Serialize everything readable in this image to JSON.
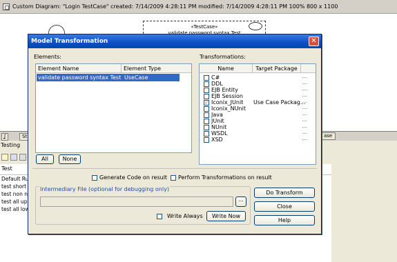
{
  "app": {
    "title_bar": "Custom Diagram: \"Login TestCase\"  created: 7/14/2009 4:28:11 PM  modified: 7/14/2009 4:28:11 PM   100%   800 x 1100",
    "usecase_stereotype": "«TestCase»",
    "usecase_name": "validate password syntax Test",
    "tab_left": "ʆ",
    "tab_st": "St",
    "tab_case": "ase",
    "testing_title": "Testing",
    "test_col": "Test",
    "test_items": [
      "Default Run",
      "test short p",
      "test non nu",
      "test all uppe",
      "test all lowe"
    ]
  },
  "dialog": {
    "title": "Model Transformation",
    "close_glyph": "✕",
    "elements_label": "Elements:",
    "col_element_name": "Element Name",
    "col_element_type": "Element Type",
    "selected_element": {
      "name": "validate password syntax Test",
      "type": "UseCase"
    },
    "btn_all": "All",
    "btn_none": "None",
    "transformations_label": "Transformations:",
    "col_name": "Name",
    "col_target_package": "Target Package",
    "transformations": [
      {
        "name": "C#",
        "checked": false,
        "package": ""
      },
      {
        "name": "DDL",
        "checked": false,
        "package": ""
      },
      {
        "name": "EJB Entity",
        "checked": false,
        "package": ""
      },
      {
        "name": "EJB Session",
        "checked": false,
        "package": ""
      },
      {
        "name": "Iconix_JUnit",
        "checked": true,
        "package": "Use Case Packag..."
      },
      {
        "name": "Iconix_NUnit",
        "checked": false,
        "package": ""
      },
      {
        "name": "Java",
        "checked": false,
        "package": ""
      },
      {
        "name": "JUnit",
        "checked": false,
        "package": ""
      },
      {
        "name": "NUnit",
        "checked": false,
        "package": ""
      },
      {
        "name": "WSDL",
        "checked": false,
        "package": ""
      },
      {
        "name": "XSD",
        "checked": false,
        "package": ""
      }
    ],
    "dots": "...",
    "gen_code_label": "Generate Code on result",
    "perform_transforms_label": "Perform Transformations on result",
    "intermediary_label": "Intermediary File (optional for debugging only)",
    "intermediary_value": "",
    "browse_label": "...",
    "write_always_label": "Write Always",
    "btn_write_now": "Write Now",
    "btn_do_transform": "Do Transform",
    "btn_close": "Close",
    "btn_help": "Help"
  }
}
